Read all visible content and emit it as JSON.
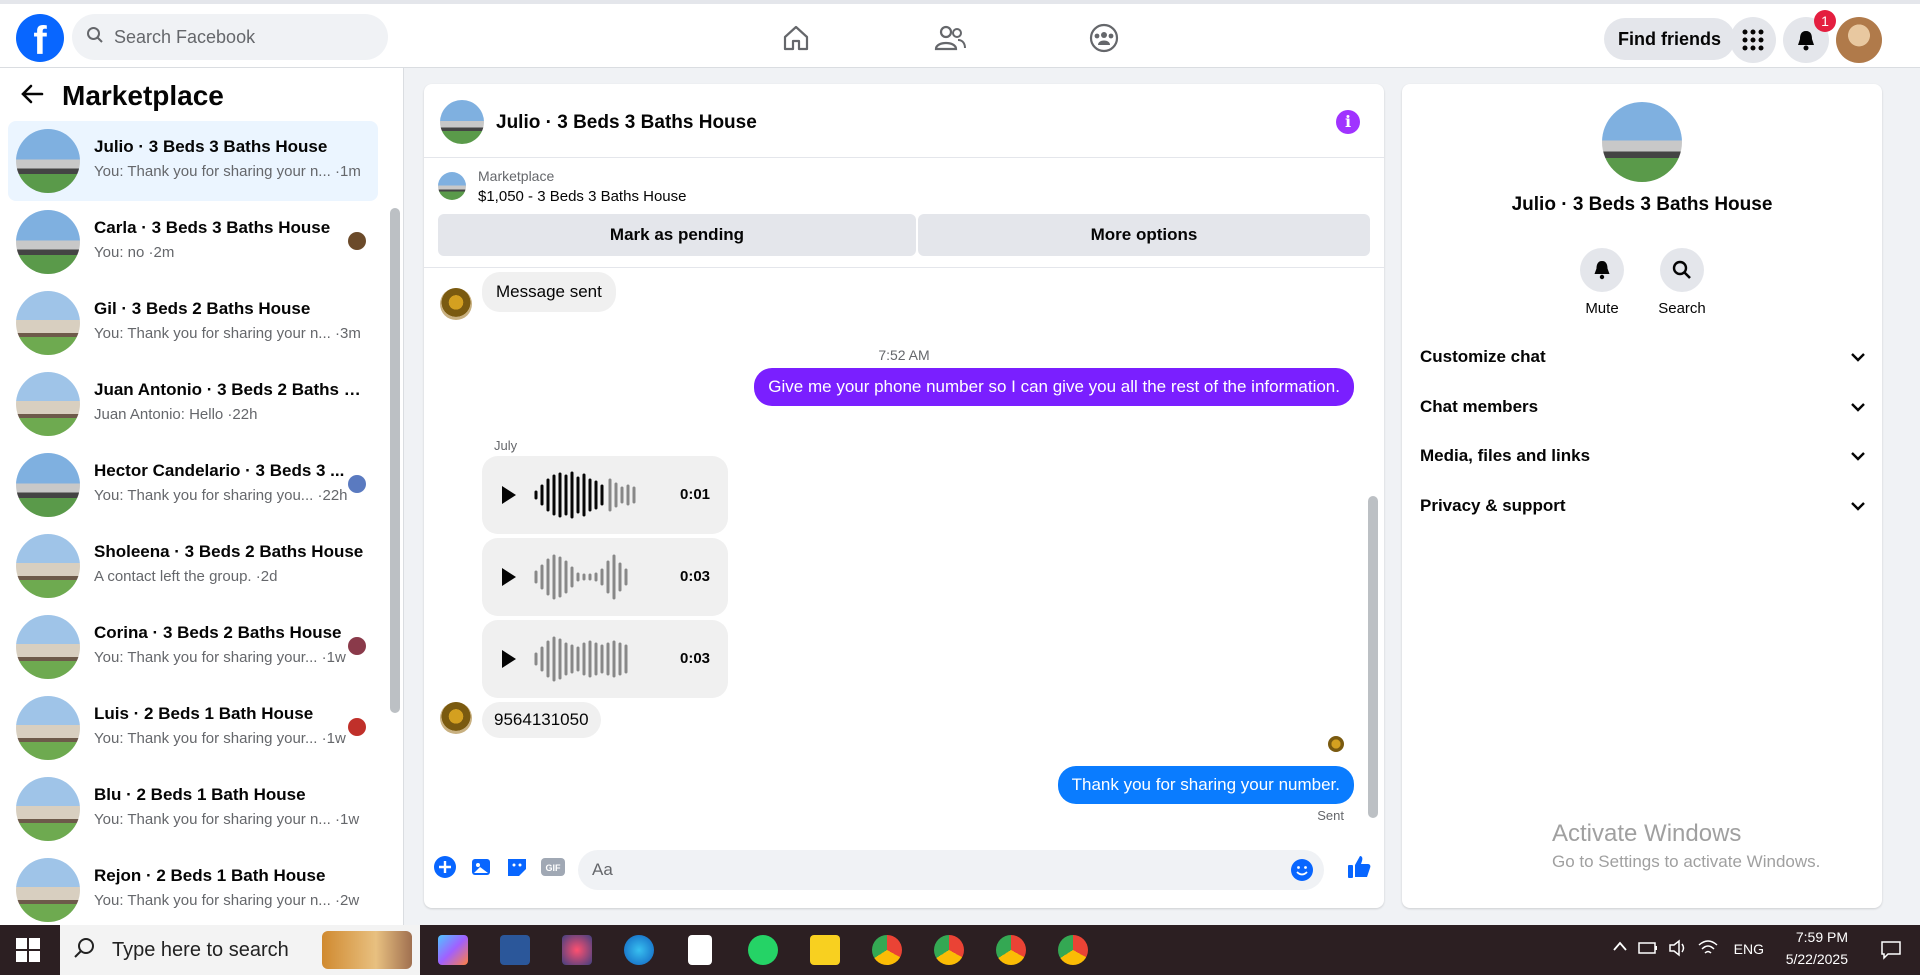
{
  "topbar": {
    "logo": "f",
    "search_placeholder": "Search Facebook",
    "find_friends": "Find friends",
    "notification_count": "1"
  },
  "sidebar": {
    "title": "Marketplace",
    "conversations": [
      {
        "name": "Julio · 3 Beds 3 Baths House",
        "preview": "You: Thank you for sharing your n... ·1m"
      },
      {
        "name": "Carla · 3 Beds 3 Baths House",
        "preview": "You: no ·2m"
      },
      {
        "name": "Gil · 3 Beds 2 Baths House",
        "preview": "You: Thank you for sharing your n... ·3m"
      },
      {
        "name": "Juan Antonio · 3 Beds 2 Baths H...",
        "preview": "Juan Antonio: Hello ·22h"
      },
      {
        "name": "Hector Candelario · 3 Beds 3 ...",
        "preview": "You: Thank you for sharing you... ·22h"
      },
      {
        "name": "Sholeena · 3 Beds 2 Baths House",
        "preview": "A contact left the group. ·2d"
      },
      {
        "name": "Corina · 3 Beds 2 Baths House",
        "preview": "You: Thank you for sharing your... ·1w"
      },
      {
        "name": "Luis · 2 Beds 1 Bath House",
        "preview": "You: Thank you for sharing your... ·1w"
      },
      {
        "name": "Blu · 2 Beds 1 Bath House",
        "preview": "You: Thank you for sharing your n... ·1w"
      },
      {
        "name": "Rejon · 2 Beds 1 Bath House",
        "preview": "You: Thank you for sharing your n... ·2w"
      }
    ]
  },
  "chat": {
    "title": "Julio · 3 Beds 3 Baths House",
    "listing_category": "Marketplace",
    "listing_price": "$1,050 - 3 Beds 3 Baths House",
    "mark_pending": "Mark as pending",
    "more_options": "More options",
    "messages": {
      "msg_sent": "Message sent",
      "timestamp": "7:52 AM",
      "outgoing_1": "Give me your phone number so I can give you all the rest of the information.",
      "july": "July",
      "audio_1": "0:01",
      "audio_2": "0:03",
      "audio_3": "0:03",
      "phone": "9564131050",
      "outgoing_2": "Thank you for sharing your number.",
      "status": "Sent"
    },
    "composer_placeholder": "Aa"
  },
  "details": {
    "title": "Julio · 3 Beds 3 Baths House",
    "mute": "Mute",
    "search": "Search",
    "sections": [
      "Customize chat",
      "Chat members",
      "Media, files and links",
      "Privacy & support"
    ]
  },
  "watermark": {
    "line1": "Activate Windows",
    "line2": "Go to Settings to activate Windows."
  },
  "taskbar": {
    "search_placeholder": "Type here to search",
    "language": "ENG",
    "time": "7:59 PM",
    "date": "5/22/2025"
  },
  "colors": {
    "brand_blue": "#0866ff",
    "outgoing_purple": "#7a1fff",
    "outgoing_blue": "#0a7cff",
    "info_purple": "#a033ff"
  }
}
